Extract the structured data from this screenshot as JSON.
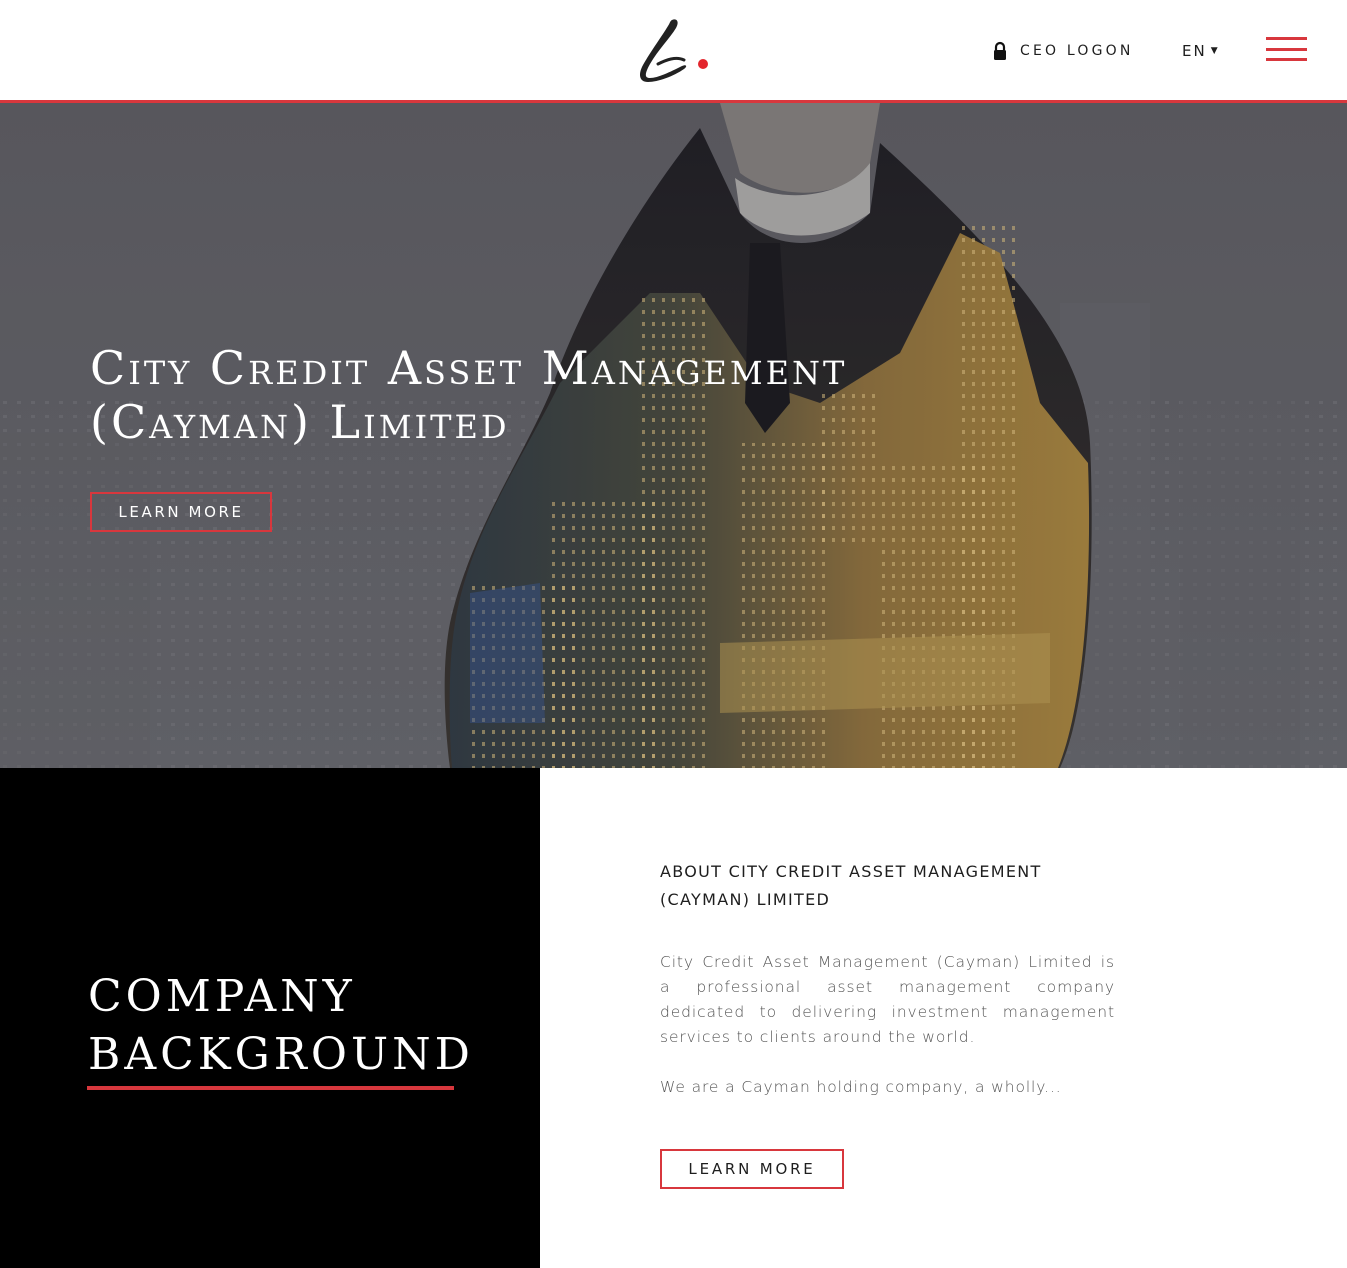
{
  "header": {
    "logo_alt": "City Credit logo",
    "ceo_logon_label": "CEO LOGON",
    "language_label": "EN",
    "accent_color": "#d8373d"
  },
  "hero": {
    "title_line1": "City Credit Asset Management",
    "title_line2": "(Cayman) Limited",
    "button_label": "LEARN MORE"
  },
  "company_background": {
    "title_line1": "COMPANY",
    "title_line2": "BACKGROUND"
  },
  "about": {
    "heading_line1": "ABOUT CITY CREDIT ASSET MANAGEMENT",
    "heading_line2": "(CAYMAN) LIMITED",
    "paragraph1": "City Credit Asset Management (Cayman) Limited is a professional asset management company dedicated to delivering investment management services to clients around the world.",
    "paragraph2": "We are a Cayman holding company, a wholly...",
    "button_label": "LEARN MORE"
  },
  "icons": {
    "lock": "lock-icon",
    "caret": "caret-down-icon",
    "menu": "hamburger-menu-icon"
  }
}
